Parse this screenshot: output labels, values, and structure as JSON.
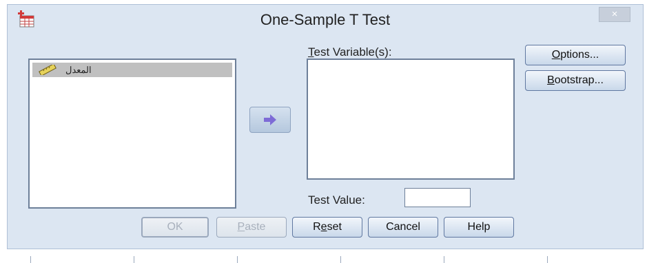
{
  "window": {
    "title": "One-Sample T Test",
    "close_glyph": "×",
    "icon": "spss-dialog-icon"
  },
  "source_list": {
    "items": [
      {
        "label": "المعدل",
        "icon": "ruler-scale-icon",
        "selected": true
      }
    ]
  },
  "move_button": {
    "icon": "right-arrow-icon"
  },
  "test_variables": {
    "label_accel": "T",
    "label_rest": "est Variable(s):",
    "items": []
  },
  "test_value": {
    "label": "Test Value:",
    "value": ""
  },
  "side_buttons": {
    "options_accel": "O",
    "options_rest": "ptions...",
    "bootstrap_accel": "B",
    "bootstrap_rest": "ootstrap..."
  },
  "buttons": {
    "ok": "OK",
    "paste_accel": "P",
    "paste_rest": "aste",
    "reset_pre": "R",
    "reset_accel": "e",
    "reset_rest": "set",
    "cancel": "Cancel",
    "help": "Help"
  },
  "colors": {
    "dialog_bg": "#dce6f2",
    "list_border": "#6d7f99",
    "selected_item": "#c0c0c0",
    "arrow": "#7d6bd6"
  }
}
